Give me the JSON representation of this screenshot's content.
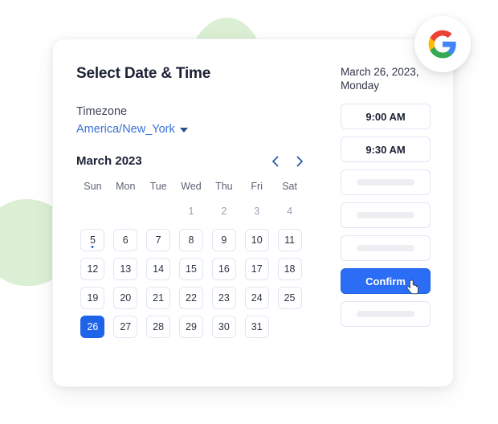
{
  "card": {
    "title": "Select Date & Time",
    "timezone_label": "Timezone",
    "timezone_value": "America/New_York",
    "timezone_caret_icon": "chevron-down-icon"
  },
  "calendar": {
    "month_label": "March 2023",
    "prev_icon": "chevron-left-icon",
    "next_icon": "chevron-right-icon",
    "day_headers": [
      "Sun",
      "Mon",
      "Tue",
      "Wed",
      "Thu",
      "Fri",
      "Sat"
    ],
    "leading_blanks": 3,
    "days": [
      {
        "n": "1",
        "state": "muted"
      },
      {
        "n": "2",
        "state": "muted"
      },
      {
        "n": "3",
        "state": "muted"
      },
      {
        "n": "4",
        "state": "muted"
      },
      {
        "n": "5",
        "state": "boxed",
        "dot": true
      },
      {
        "n": "6",
        "state": "boxed"
      },
      {
        "n": "7",
        "state": "boxed"
      },
      {
        "n": "8",
        "state": "boxed"
      },
      {
        "n": "9",
        "state": "boxed"
      },
      {
        "n": "10",
        "state": "boxed"
      },
      {
        "n": "11",
        "state": "boxed"
      },
      {
        "n": "12",
        "state": "boxed"
      },
      {
        "n": "13",
        "state": "boxed"
      },
      {
        "n": "14",
        "state": "boxed"
      },
      {
        "n": "15",
        "state": "boxed"
      },
      {
        "n": "16",
        "state": "boxed"
      },
      {
        "n": "17",
        "state": "boxed"
      },
      {
        "n": "18",
        "state": "boxed"
      },
      {
        "n": "19",
        "state": "boxed"
      },
      {
        "n": "20",
        "state": "boxed"
      },
      {
        "n": "21",
        "state": "boxed"
      },
      {
        "n": "22",
        "state": "boxed"
      },
      {
        "n": "23",
        "state": "boxed"
      },
      {
        "n": "24",
        "state": "boxed"
      },
      {
        "n": "25",
        "state": "boxed"
      },
      {
        "n": "26",
        "state": "selected"
      },
      {
        "n": "27",
        "state": "boxed"
      },
      {
        "n": "28",
        "state": "boxed"
      },
      {
        "n": "29",
        "state": "boxed"
      },
      {
        "n": "30",
        "state": "boxed"
      },
      {
        "n": "31",
        "state": "boxed"
      }
    ]
  },
  "slots_panel": {
    "selected_date_line1": "March 26, 2023,",
    "selected_date_line2": "Monday",
    "slots": [
      {
        "type": "time",
        "label": "9:00 AM"
      },
      {
        "type": "time",
        "label": "9:30 AM"
      },
      {
        "type": "skeleton"
      },
      {
        "type": "skeleton"
      },
      {
        "type": "skeleton"
      },
      {
        "type": "confirm",
        "label": "Confirm",
        "cursor_icon": "hand-pointer-cursor-icon"
      },
      {
        "type": "skeleton"
      }
    ]
  },
  "branding": {
    "logo_icon": "google-g-logo-icon"
  },
  "colors": {
    "accent_blue": "#2b6df4",
    "selected_blue": "#1f63e8",
    "link_blue": "#3a6fd8",
    "border": "#dfe6f4",
    "skeleton": "#eceef1",
    "blob_green": "#cfe9c6",
    "google_blue": "#4285f4",
    "google_red": "#ea4335",
    "google_yellow": "#fbbc05",
    "google_green": "#34a853"
  }
}
